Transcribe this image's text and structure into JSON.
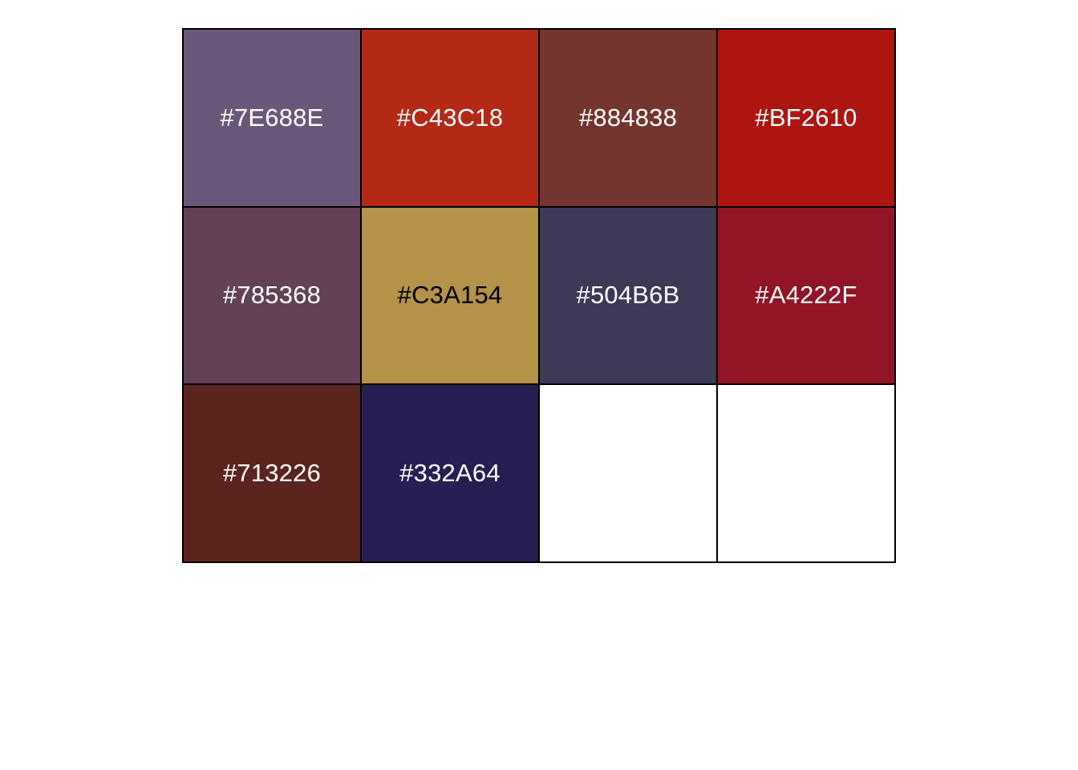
{
  "swatches": [
    {
      "label": "#7E688E",
      "color": "#6A577A",
      "text_color": "#FFFFFF"
    },
    {
      "label": "#C43C18",
      "color": "#B42915",
      "text_color": "#FFFFFF"
    },
    {
      "label": "#884838",
      "color": "#73352D",
      "text_color": "#FFFFFF"
    },
    {
      "label": "#BF2610",
      "color": "#AD1610",
      "text_color": "#FFFFFF"
    },
    {
      "label": "#785368",
      "color": "#634156",
      "text_color": "#FFFFFF"
    },
    {
      "label": "#C3A154",
      "color": "#B49247",
      "text_color": "#000000"
    },
    {
      "label": "#504B6B",
      "color": "#3E3957",
      "text_color": "#FFFFFF"
    },
    {
      "label": "#A4222F",
      "color": "#921427",
      "text_color": "#FFFFFF"
    },
    {
      "label": "#713226",
      "color": "#5C241F",
      "text_color": "#FFFFFF"
    },
    {
      "label": "#332A64",
      "color": "#271F53",
      "text_color": "#FFFFFF"
    },
    {
      "label": "",
      "color": "#FFFFFF",
      "text_color": "#000000"
    },
    {
      "label": "",
      "color": "#FFFFFF",
      "text_color": "#000000"
    }
  ]
}
